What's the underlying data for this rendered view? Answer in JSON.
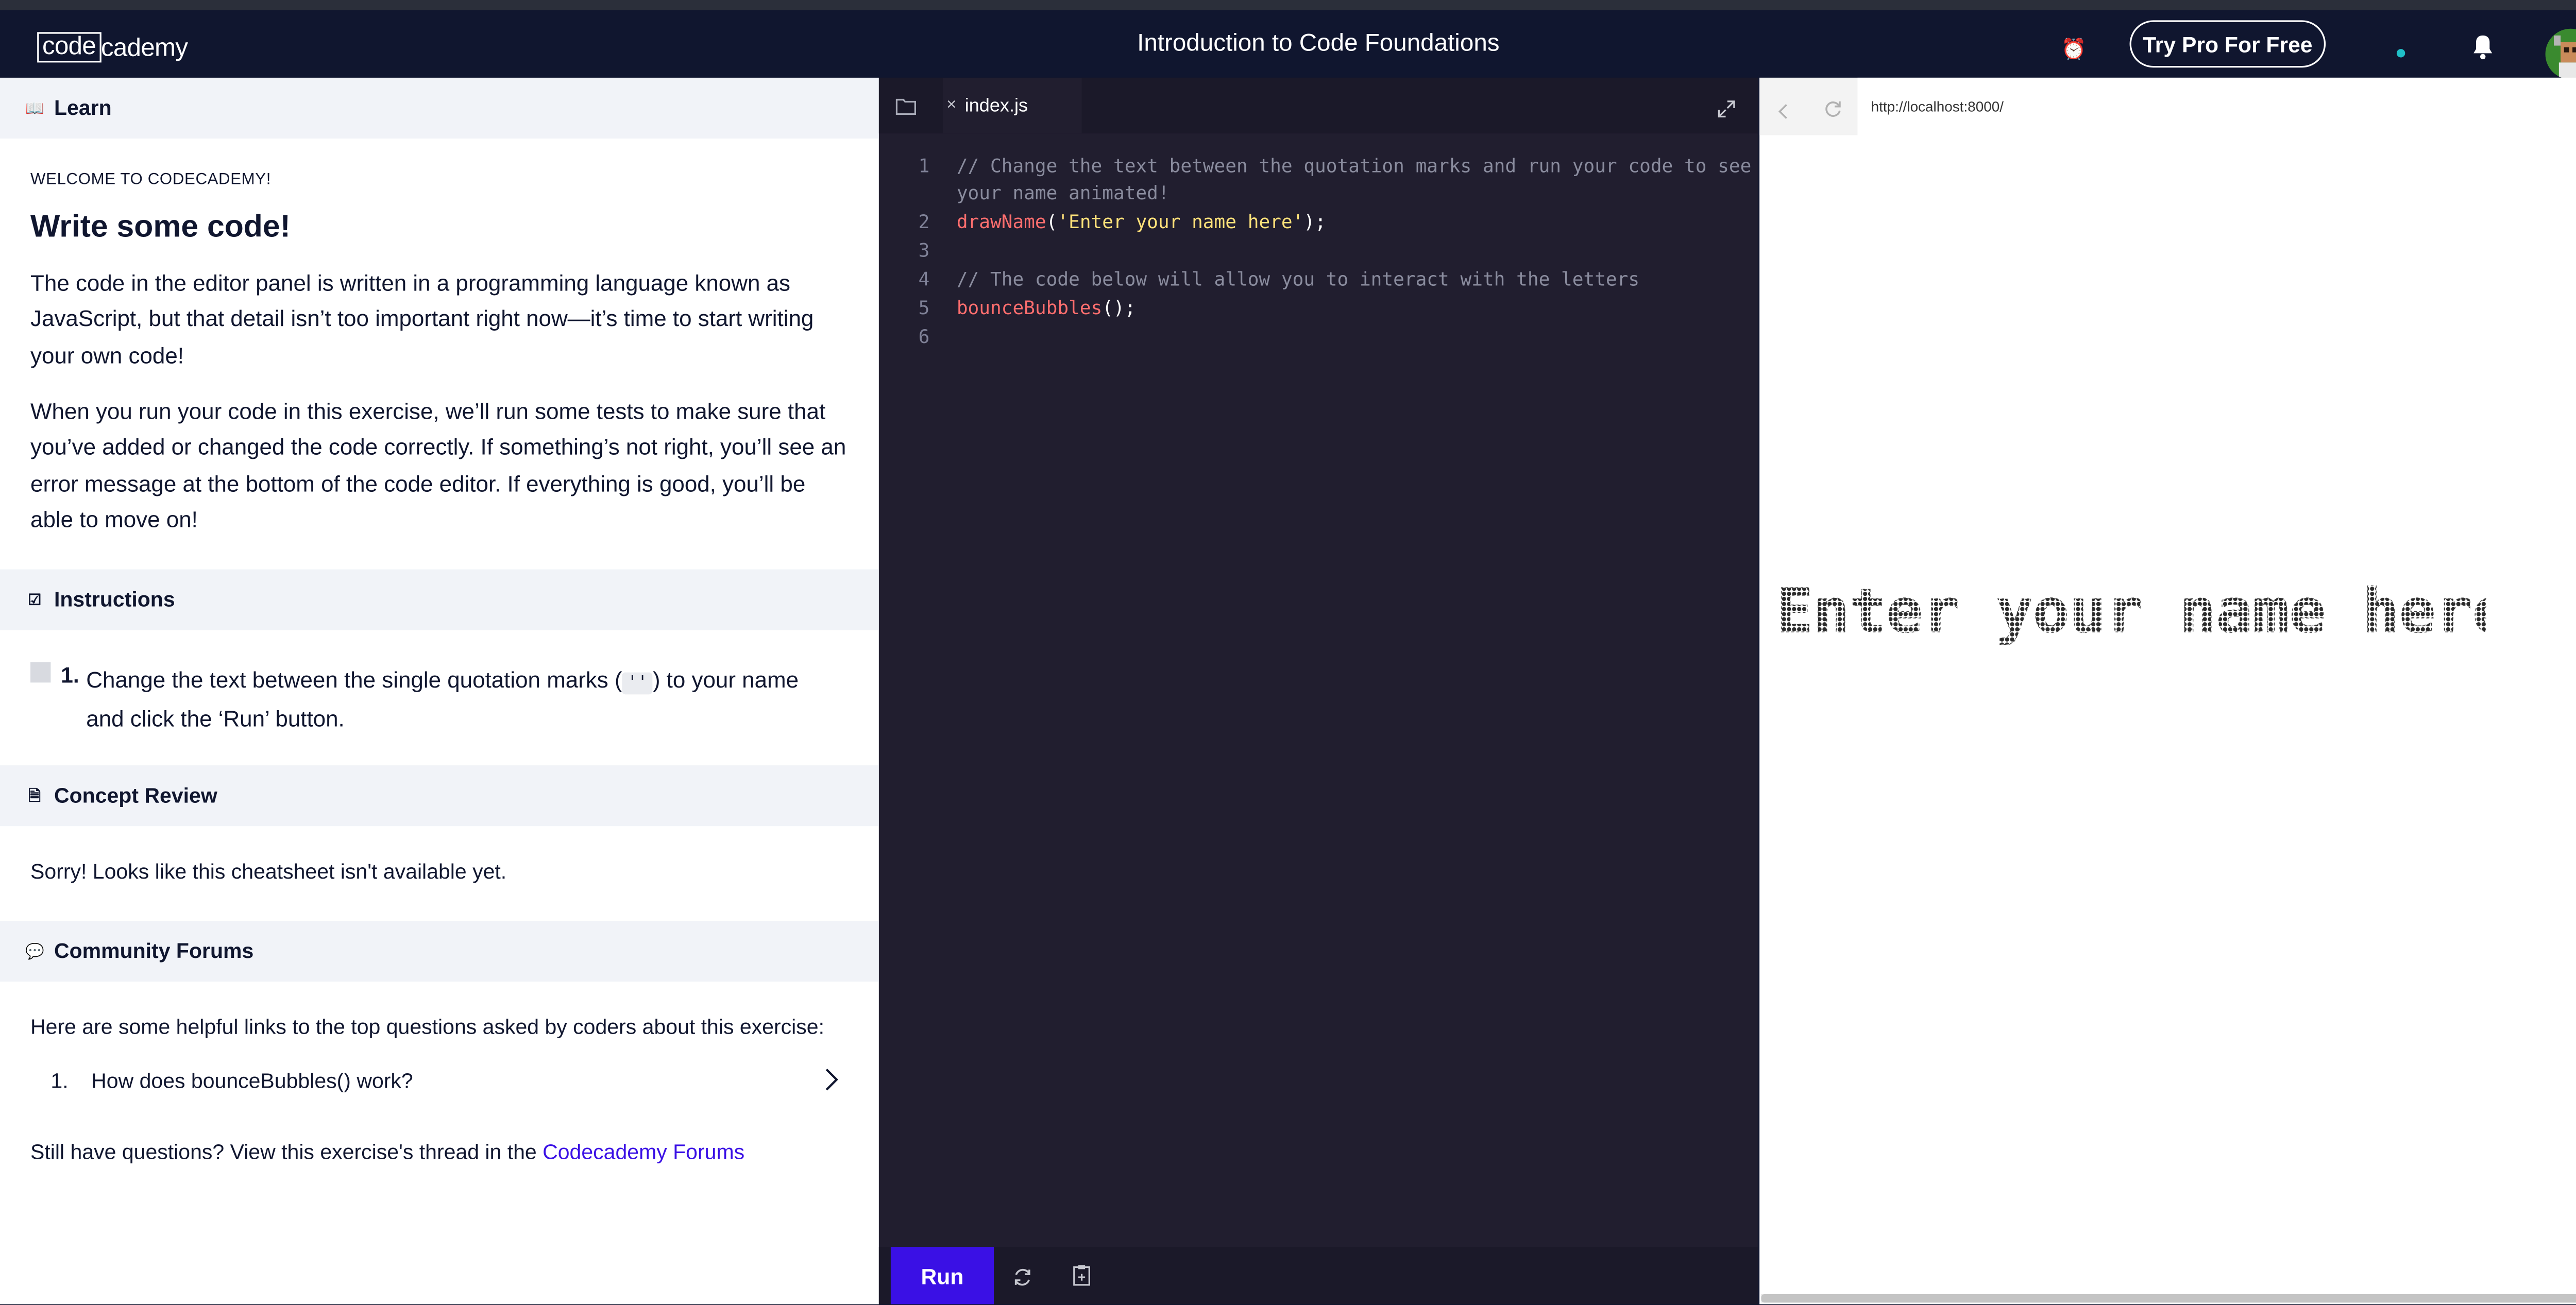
{
  "header": {
    "logo_part1": "code",
    "logo_part2": "cademy",
    "course_title": "Introduction to Code Foundations",
    "pro_button": "Try Pro For Free"
  },
  "learn": {
    "section_title": "Learn",
    "eyebrow": "WELCOME TO CODECADEMY!",
    "heading": "Write some code!",
    "paragraph1": "The code in the editor panel is written in a programming language known as JavaScript, but that detail isn’t too important right now—it’s time to start writing your own code!",
    "paragraph2": "When you run your code in this exercise, we’ll run some tests to make sure that you’ve added or changed the code correctly. If something’s not right, you’ll see an error message at the bottom of the code editor. If everything is good, you’ll be able to move on!"
  },
  "instructions": {
    "section_title": "Instructions",
    "step_number": "1.",
    "step_text_before": "Change the text between the single quotation marks (",
    "step_code": "''",
    "step_text_after": ") to your name and click the ‘Run’ button."
  },
  "concept_review": {
    "section_title": "Concept Review",
    "message": "Sorry! Looks like this cheatsheet isn't available yet."
  },
  "community": {
    "section_title": "Community Forums",
    "intro": "Here are some helpful links to the top questions asked by coders about this exercise:",
    "questions": [
      {
        "number": "1.",
        "text": "How does bounceBubbles() work?"
      }
    ],
    "footer_text": "Still have questions? View this exercise's thread in the ",
    "footer_link": "Codecademy Forums"
  },
  "editor": {
    "tab_close": "×",
    "tab_name": "index.js",
    "lines": [
      {
        "n": "1",
        "text": "// Change the text between the quotation marks and run your code to see"
      },
      {
        "n": "",
        "text": "your name animated!"
      },
      {
        "n": "2",
        "fn": "drawName",
        "p1": "(",
        "str": "'Enter your name here'",
        "p2": ");"
      },
      {
        "n": "3",
        "text": ""
      },
      {
        "n": "4",
        "text": "// The code below will allow you to interact with the letters"
      },
      {
        "n": "5",
        "fn": "bounceBubbles",
        "p1": "();"
      },
      {
        "n": "6",
        "text": ""
      }
    ],
    "run_button": "Run"
  },
  "browser": {
    "url": "http://localhost:8000/",
    "preview_text": "Enter your name here"
  },
  "colors": {
    "header_bg": "#10162f",
    "editor_bg": "#211e2f",
    "run_button": "#3a10e5",
    "link": "#3a10e5",
    "status_dot": "#1fc0c8"
  }
}
